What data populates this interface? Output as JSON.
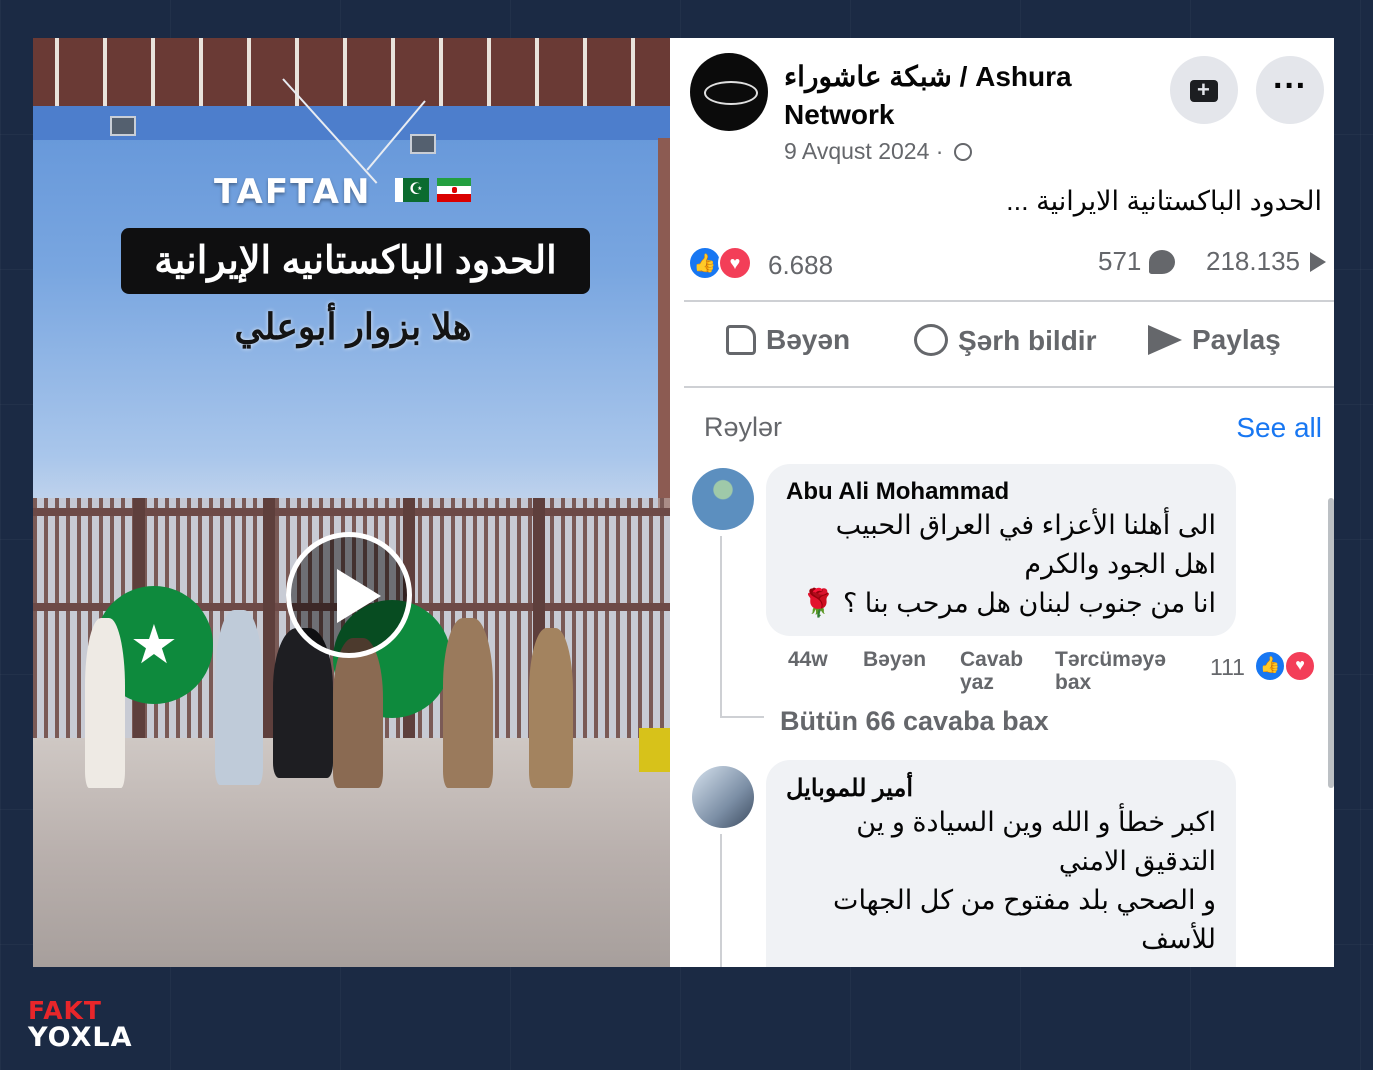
{
  "video": {
    "location_label": "TAFTAN",
    "banner_text": "الحدود الباكستانيه الإيرانية",
    "subtitle_text": "هلا بزوار أبوعلي",
    "play_icon": "play-icon"
  },
  "post": {
    "page_name": "شبكة عاشوراء / Ashura Network",
    "date": "9 Avqust 2024 ·",
    "text": "الحدود الباكستانية الايرانية ...",
    "reaction_count": "6.688",
    "comment_count": "571",
    "view_count": "218.135",
    "actions": {
      "like": "Bəyən",
      "comment": "Şərh bildir",
      "share": "Paylaş"
    }
  },
  "comments_section": {
    "label": "Rəylər",
    "see_all": "See all",
    "comments": [
      {
        "author": "Abu Ali Mohammad",
        "lines": [
          "الى أهلنا الأعزاء في العراق الحبيب",
          "اهل الجود والكرم",
          "انا من جنوب لبنان هل مرحب بنا ؟ 🌹"
        ],
        "time": "44w",
        "like_label": "Bəyən",
        "reply_label": "Cavab yaz",
        "translate_label": "Tərcüməyə bax",
        "reaction_count": "111"
      },
      {
        "author": "أمير للموبايل",
        "lines": [
          "اكبر خطأ و الله وين السيادة و ين",
          "التدقيق الامني",
          "و الصحي بلد مفتوح من كل الجهات",
          "للأسف"
        ]
      }
    ],
    "view_replies": "Bütün 66 cavaba bax"
  },
  "logo": {
    "top": "FAKT",
    "bottom": "YOXLA"
  },
  "colors": {
    "background": "#1b2a44",
    "facebook_blue": "#1877f2",
    "love_red": "#f33e58",
    "brand_red": "#e8262a"
  }
}
